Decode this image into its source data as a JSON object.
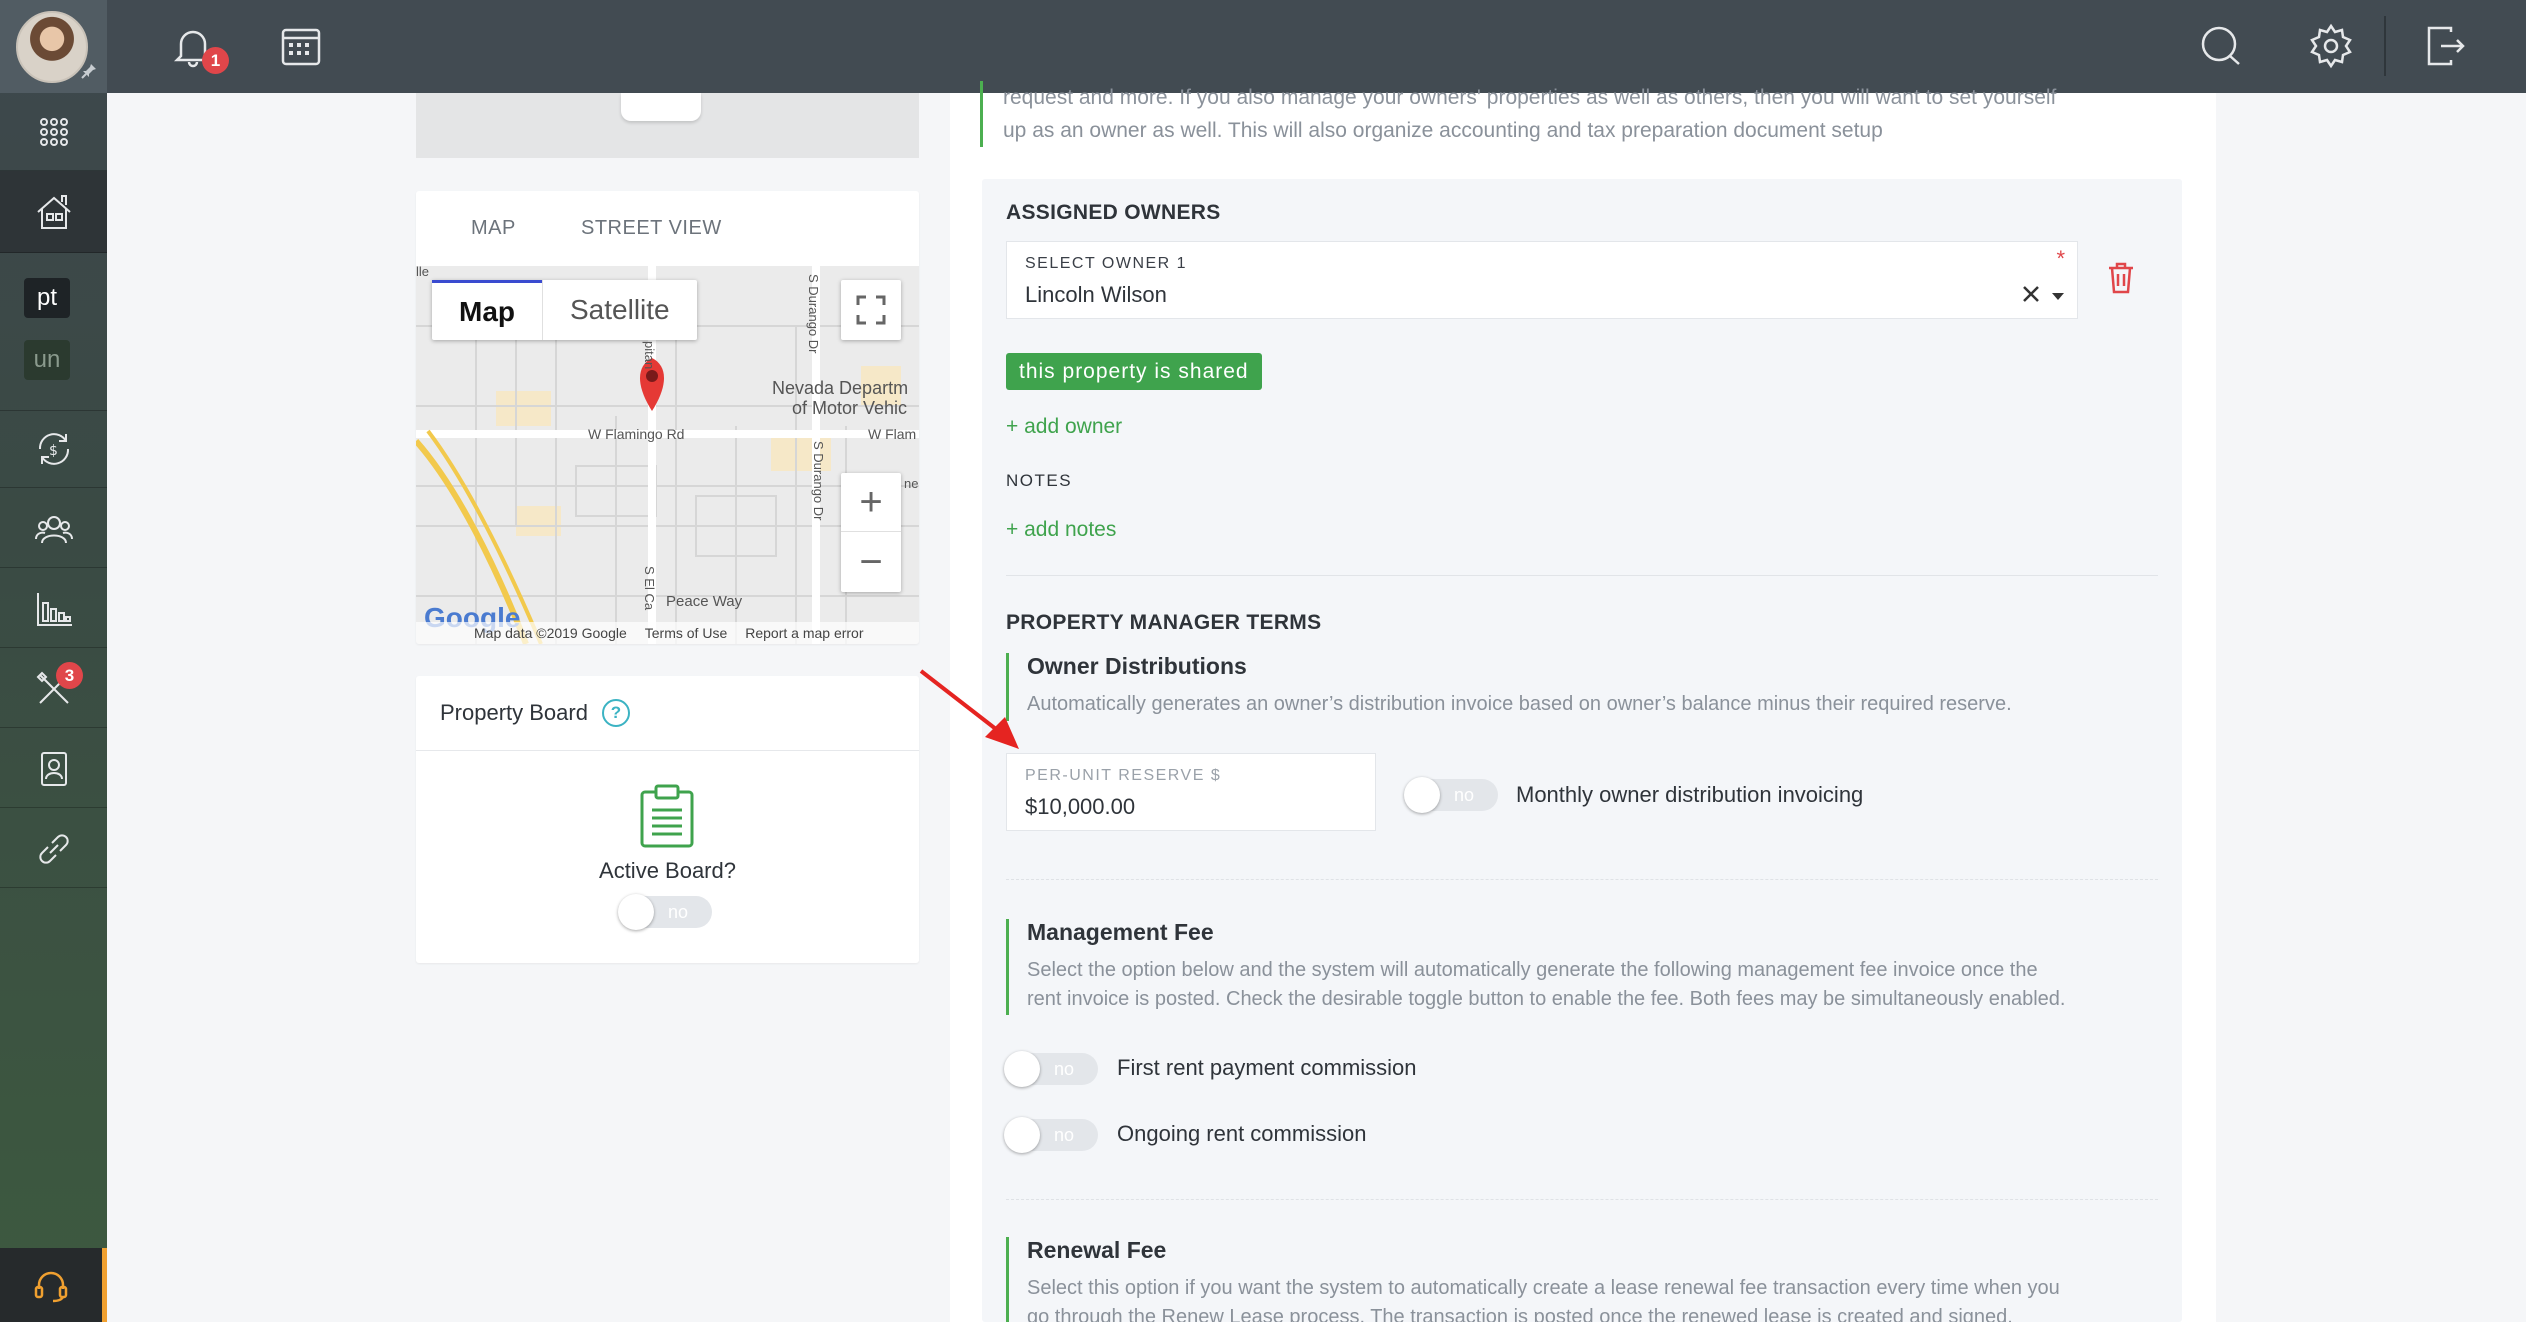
{
  "topbar": {
    "notification_count": "1"
  },
  "sidebar": {
    "chip_pt": "pt",
    "chip_un": "un",
    "tools_badge": "3"
  },
  "map": {
    "tab_map": "MAP",
    "tab_street": "STREET VIEW",
    "btn_map": "Map",
    "btn_satellite": "Satellite",
    "labels": [
      "Nevada Departm",
      "of Motor Vehic",
      "W Flamingo Rd",
      "W Flam",
      "Peace Way",
      "S Durango Dr",
      "S Durango Dr",
      "S El Ca",
      "pitan",
      "lle",
      "ne"
    ],
    "google": "Google",
    "footer": [
      "Map data ©2019 Google",
      "Terms of Use",
      "Report a map error"
    ]
  },
  "board": {
    "title": "Property Board",
    "help": "?",
    "active_label": "Active Board?",
    "toggle_text": "no"
  },
  "main": {
    "intro_line1": "request and more. If you also manage your owners' properties as well as others, then you will want to set yourself",
    "intro_line2": "up as an owner as well. This will also organize accounting and tax preparation document setup",
    "assigned_title": "ASSIGNED OWNERS",
    "owner_label": "SELECT OWNER 1",
    "owner_required": "*",
    "owner_value": "Lincoln Wilson",
    "shared_badge": "this property is shared",
    "add_owner": "+ add owner",
    "notes_title": "NOTES",
    "add_notes": "+ add notes",
    "pm_terms_title": "PROPERTY MANAGER TERMS",
    "owner_dist": {
      "title": "Owner Distributions",
      "desc": "Automatically generates an owner’s distribution invoice based on owner’s balance minus their required reserve.",
      "reserve_label": "PER-UNIT RESERVE $",
      "reserve_value": "$10,000.00",
      "toggle_text": "no",
      "toggle_label": "Monthly owner distribution invoicing"
    },
    "mgmt_fee": {
      "title": "Management Fee",
      "desc1": "Select the option below and the system will automatically generate the following management fee invoice once the",
      "desc2": "rent invoice is posted. Check the desirable toggle button to enable the fee. Both fees may be simultaneously enabled.",
      "first_toggle_text": "no",
      "first_label": "First rent payment commission",
      "ongoing_toggle_text": "no",
      "ongoing_label": "Ongoing rent commission"
    },
    "renewal_fee": {
      "title": "Renewal Fee",
      "desc1": "Select this option if you want the system to automatically create a lease renewal fee transaction every time when you",
      "desc2": "go through the Renew Lease process. The transaction is posted once the renewed lease is created and signed."
    }
  }
}
